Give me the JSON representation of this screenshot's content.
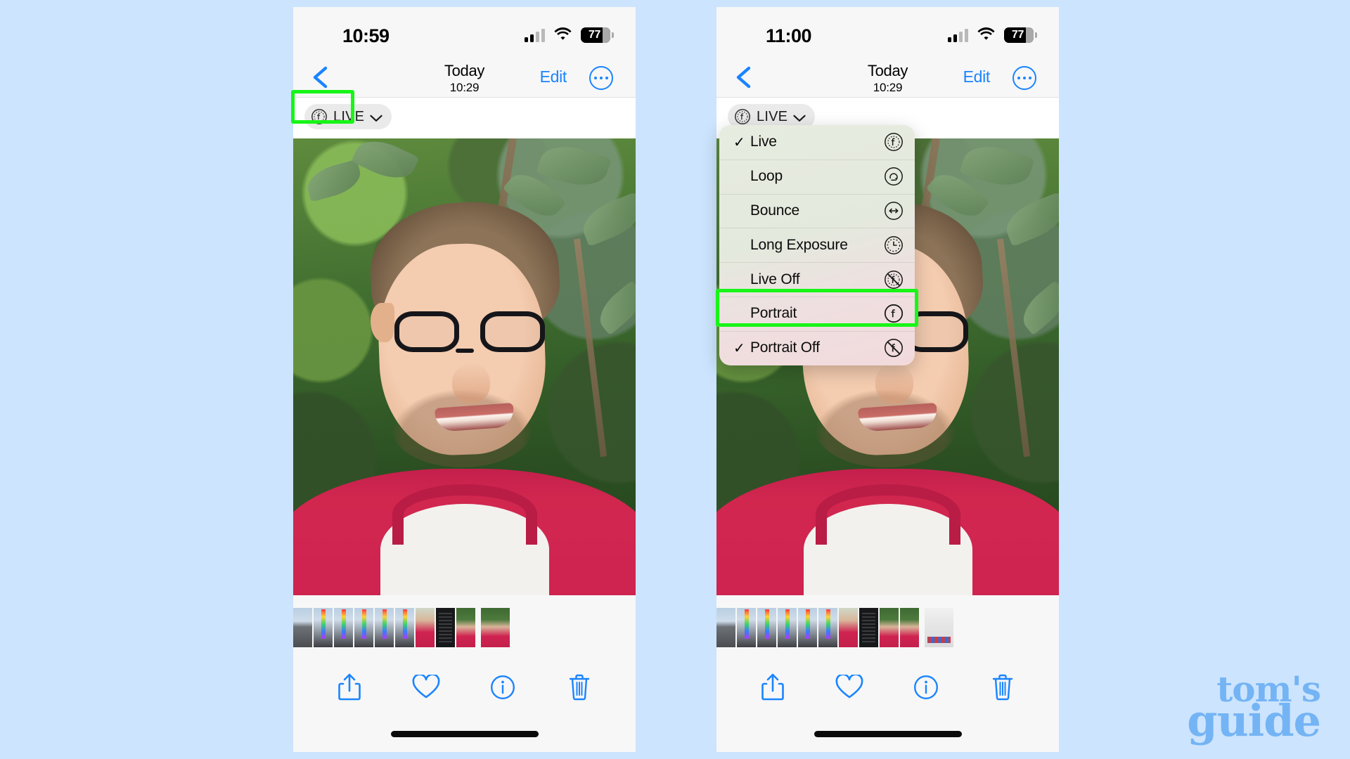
{
  "page": {
    "background_color": "#cce4fd",
    "accent_blue": "#1a84ff",
    "highlight_green": "#18f518"
  },
  "watermark": {
    "line1": "tom's",
    "line2": "guide"
  },
  "phones": [
    {
      "id": "left",
      "status": {
        "time": "10:59",
        "battery_percent": "77",
        "signal_icon": "cellular-signal-icon",
        "wifi_icon": "wifi-icon",
        "battery_icon": "battery-icon"
      },
      "nav": {
        "back_icon": "chevron-left-icon",
        "title": "Today",
        "subtitle": "10:29",
        "edit_label": "Edit",
        "more_icon": "ellipsis-circle-icon"
      },
      "live_badge": {
        "label": "LIVE",
        "glyph_icon": "live-photo-icon",
        "chevron_icon": "chevron-down-icon",
        "highlighted": true
      },
      "toolbar": [
        {
          "name": "share-button",
          "icon": "share-icon"
        },
        {
          "name": "favorite-button",
          "icon": "heart-icon"
        },
        {
          "name": "info-button",
          "icon": "info-circle-icon"
        },
        {
          "name": "delete-button",
          "icon": "trash-icon"
        }
      ],
      "menu_open": false
    },
    {
      "id": "right",
      "status": {
        "time": "11:00",
        "battery_percent": "77",
        "signal_icon": "cellular-signal-icon",
        "wifi_icon": "wifi-icon",
        "battery_icon": "battery-icon"
      },
      "nav": {
        "back_icon": "chevron-left-icon",
        "title": "Today",
        "subtitle": "10:29",
        "edit_label": "Edit",
        "more_icon": "ellipsis-circle-icon"
      },
      "live_badge": {
        "label": "LIVE",
        "glyph_icon": "live-photo-icon",
        "chevron_icon": "chevron-down-icon",
        "highlighted": false
      },
      "toolbar": [
        {
          "name": "share-button",
          "icon": "share-icon"
        },
        {
          "name": "favorite-button",
          "icon": "heart-icon"
        },
        {
          "name": "info-button",
          "icon": "info-circle-icon"
        },
        {
          "name": "delete-button",
          "icon": "trash-icon"
        }
      ],
      "menu_open": true
    }
  ],
  "live_menu": {
    "items": [
      {
        "label": "Live",
        "checked": true,
        "icon": "live-photo-icon",
        "highlighted": false
      },
      {
        "label": "Loop",
        "checked": false,
        "icon": "loop-icon",
        "highlighted": false
      },
      {
        "label": "Bounce",
        "checked": false,
        "icon": "bounce-arrows-icon",
        "highlighted": false
      },
      {
        "label": "Long Exposure",
        "checked": false,
        "icon": "long-exposure-icon",
        "highlighted": false
      },
      {
        "label": "Live Off",
        "checked": false,
        "icon": "live-photo-off-icon",
        "highlighted": false
      },
      {
        "label": "Portrait",
        "checked": false,
        "icon": "portrait-icon",
        "highlighted": true
      },
      {
        "label": "Portrait Off",
        "checked": true,
        "icon": "portrait-off-icon",
        "highlighted": false
      }
    ],
    "check_glyph": "✓"
  },
  "filmstrip": {
    "left": [
      "street",
      "tower",
      "tower",
      "tower",
      "tower",
      "tower",
      "person",
      "dark",
      "leafy",
      "leafy"
    ],
    "right": [
      "street",
      "tower",
      "tower",
      "tower",
      "tower",
      "tower",
      "person",
      "dark",
      "leafy",
      "leafy",
      "light"
    ]
  }
}
